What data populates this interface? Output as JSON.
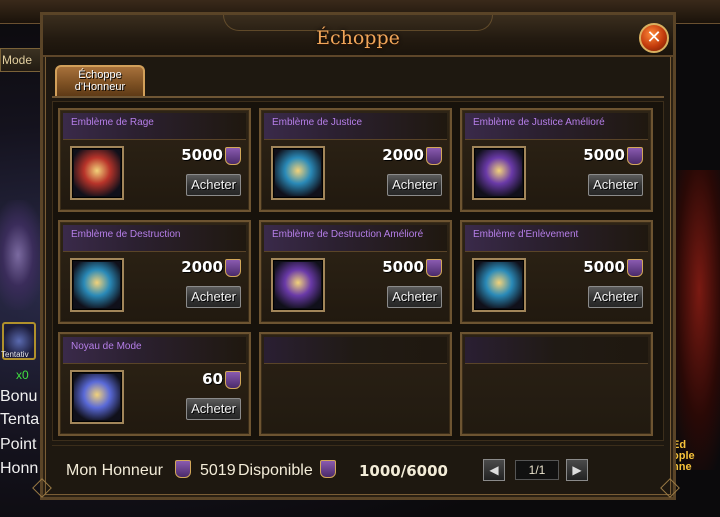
{
  "background": {
    "mode_label": "Mode",
    "tentative_label": "Tentativ",
    "count_label": "x0",
    "side_lines": [
      "Bonu",
      "Tenta",
      "Point",
      "Honn"
    ],
    "right_logo": "Ed\nople\nnne"
  },
  "window": {
    "title": "Échoppe",
    "close_label": "✕"
  },
  "tabs": [
    {
      "label": "Échoppe d'Honneur",
      "active": true
    }
  ],
  "shop": {
    "currency_icon": "honor-emblem-icon",
    "buy_label": "Acheter",
    "items": [
      {
        "name": "Emblème de Rage",
        "price": "5000",
        "icon": "rage-emblem-icon",
        "accent": "#b8342a"
      },
      {
        "name": "Emblème de Justice",
        "price": "2000",
        "icon": "justice-emblem-icon",
        "accent": "#2a8ab8"
      },
      {
        "name": "Emblème de Justice Amélioré",
        "price": "5000",
        "icon": "improved-justice-emblem-icon",
        "accent": "#6a3aa8"
      },
      {
        "name": "Emblème de Destruction",
        "price": "2000",
        "icon": "destruction-emblem-icon",
        "accent": "#2a8ab8"
      },
      {
        "name": "Emblème de Destruction Amélioré",
        "price": "5000",
        "icon": "improved-destruction-emblem-icon",
        "accent": "#6a3aa8"
      },
      {
        "name": "Emblème d'Enlèvement",
        "price": "5000",
        "icon": "abduction-emblem-icon",
        "accent": "#2a8ab8"
      },
      {
        "name": "Noyau de Mode",
        "price": "60",
        "icon": "mode-core-icon",
        "accent": "#5a6ad8"
      }
    ],
    "empty_slots": 2
  },
  "footer": {
    "honor_label": "Mon Honneur",
    "honor_value": "5019",
    "available_label": "Disponible",
    "available_value": "1000/6000",
    "page": "1/1",
    "prev_label": "◀",
    "next_label": "▶"
  }
}
